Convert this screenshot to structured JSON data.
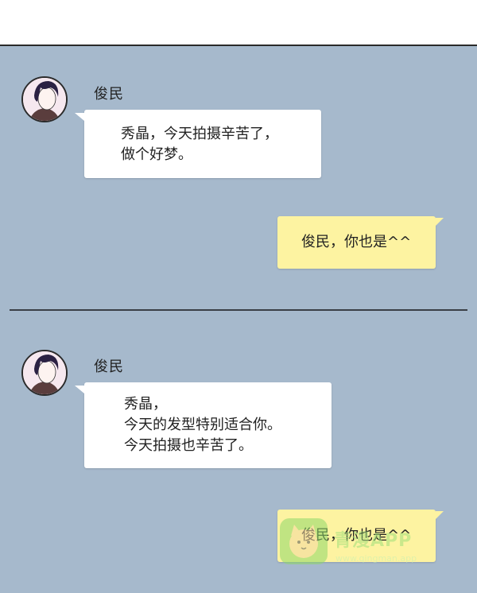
{
  "panel1": {
    "sender_name": "俊民",
    "message_lines": [
      "秀晶，今天拍摄辛苦了，",
      "做个好梦。"
    ],
    "reply": "俊民，你也是^^"
  },
  "panel2": {
    "sender_name": "俊民",
    "message_lines": [
      "秀晶，",
      "今天的发型特别适合你。",
      "今天拍摄也辛苦了。"
    ],
    "reply": "俊民，你也是^^"
  },
  "watermark": {
    "text": "青漫APP",
    "subtext": "www.qingman.app"
  },
  "colors": {
    "chat_background": "#a6b9cc",
    "incoming_bubble": "#ffffff",
    "outgoing_bubble": "#fdf3a1"
  }
}
